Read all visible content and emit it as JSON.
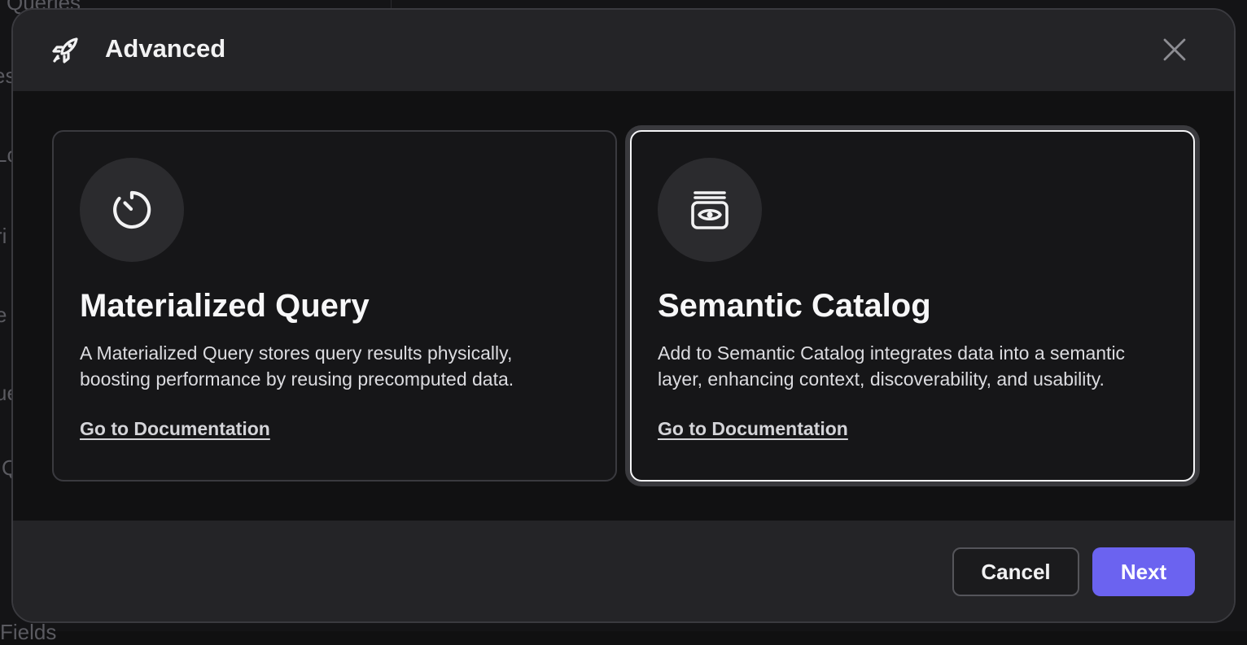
{
  "background": {
    "fragments": [
      "Queries",
      "es",
      "Lo",
      "ri",
      "e",
      "ue",
      "Q",
      "Fields"
    ]
  },
  "modal": {
    "title": "Advanced",
    "header_icon": "rocket-icon",
    "close_icon": "close-icon"
  },
  "cards": [
    {
      "icon": "timer-icon",
      "title": "Materialized Query",
      "description": "A Materialized Query stores query results physically, boosting performance by reusing precomputed data.",
      "link": "Go to Documentation",
      "selected": false
    },
    {
      "icon": "catalog-eye-icon",
      "title": "Semantic Catalog",
      "description": "Add to Semantic Catalog integrates data into a semantic layer, enhancing context, discoverability, and usability.",
      "link": "Go to Documentation",
      "selected": true
    }
  ],
  "footer": {
    "cancel_label": "Cancel",
    "next_label": "Next"
  },
  "colors": {
    "accent": "#6b63f0",
    "selected_border": "#f5f5f7"
  }
}
